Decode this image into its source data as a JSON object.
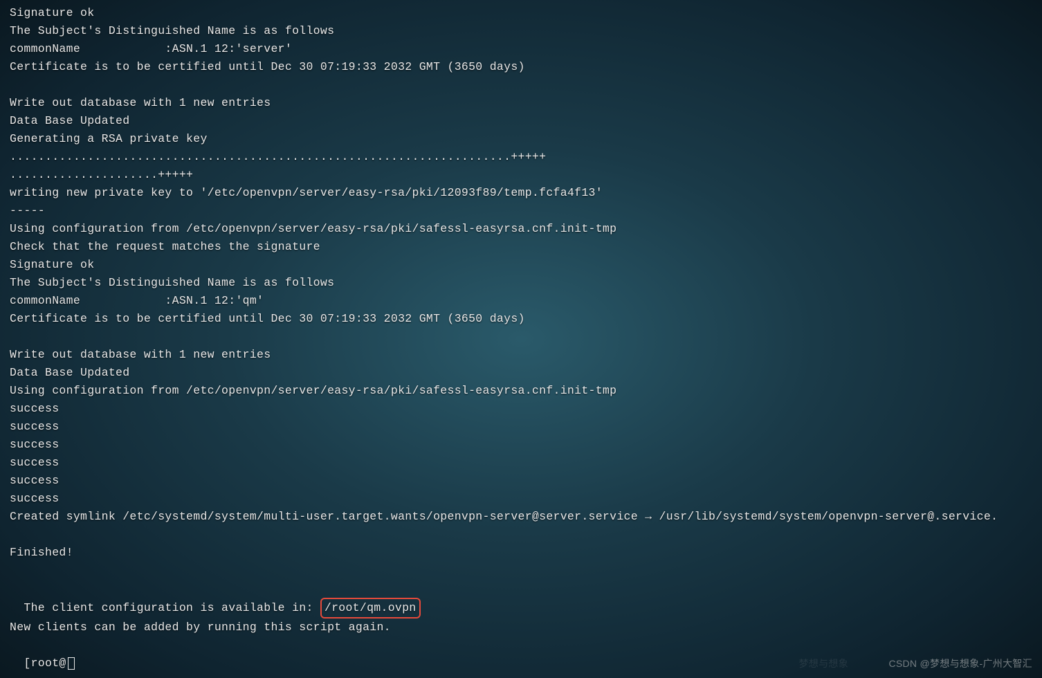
{
  "terminal": {
    "lines": [
      "Signature ok",
      "The Subject's Distinguished Name is as follows",
      "commonName            :ASN.1 12:'server'",
      "Certificate is to be certified until Dec 30 07:19:33 2032 GMT (3650 days)",
      "",
      "Write out database with 1 new entries",
      "Data Base Updated",
      "Generating a RSA private key",
      ".......................................................................+++++",
      ".....................+++++",
      "writing new private key to '/etc/openvpn/server/easy-rsa/pki/12093f89/temp.fcfa4f13'",
      "-----",
      "Using configuration from /etc/openvpn/server/easy-rsa/pki/safessl-easyrsa.cnf.init-tmp",
      "Check that the request matches the signature",
      "Signature ok",
      "The Subject's Distinguished Name is as follows",
      "commonName            :ASN.1 12:'qm'",
      "Certificate is to be certified until Dec 30 07:19:33 2032 GMT (3650 days)",
      "",
      "Write out database with 1 new entries",
      "Data Base Updated",
      "Using configuration from /etc/openvpn/server/easy-rsa/pki/safessl-easyrsa.cnf.init-tmp",
      "success",
      "success",
      "success",
      "success",
      "success",
      "success",
      "Created symlink /etc/systemd/system/multi-user.target.wants/openvpn-server@server.service → /usr/lib/systemd/system/openvpn-server@.service.",
      "",
      "Finished!",
      ""
    ],
    "config_line_prefix": "The client configuration is available in: ",
    "config_path": "/root/qm.ovpn",
    "last_line": "New clients can be added by running this script again.",
    "prompt_fragment": "[root@"
  },
  "watermark": "CSDN @梦想与想象-广州大智汇",
  "watermarkfaint": "梦想与想象"
}
